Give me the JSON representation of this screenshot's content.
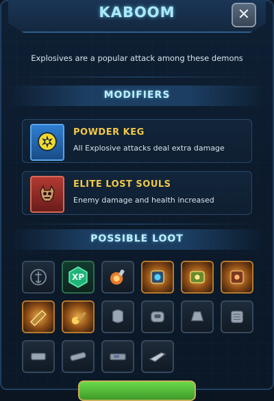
{
  "dialog": {
    "title": "KABOOM",
    "description": "Explosives are a popular attack among these demons"
  },
  "modifiers_section": {
    "title": "MODIFIERS"
  },
  "modifiers": [
    {
      "name": "POWDER KEG",
      "description": "All Explosive attacks deal extra damage",
      "icon": "explosion-icon",
      "color": "#2e7fd1"
    },
    {
      "name": "ELITE LOST SOULS",
      "description": "Enemy damage and health increased",
      "icon": "demon-skull-icon",
      "color": "#b33a32"
    }
  ],
  "loot_section": {
    "title": "POSSIBLE LOOT"
  },
  "loot_items": [
    {
      "icon": "emblem-icon",
      "style": "dark",
      "label": ""
    },
    {
      "icon": "xp-icon",
      "style": "green",
      "label": "XP"
    },
    {
      "icon": "explosive-rune-icon",
      "style": "dark",
      "label": ""
    },
    {
      "icon": "mod-cell-icon",
      "style": "orange",
      "label": ""
    },
    {
      "icon": "mod-cell-icon",
      "style": "orange",
      "label": ""
    },
    {
      "icon": "mod-cell-icon",
      "style": "orange",
      "label": ""
    },
    {
      "icon": "weapon-mod-icon",
      "style": "orange",
      "label": ""
    },
    {
      "icon": "weapon-mod-icon",
      "style": "orange",
      "label": ""
    },
    {
      "icon": "armor-piece-icon",
      "style": "dark",
      "label": ""
    },
    {
      "icon": "armor-piece-icon",
      "style": "dark",
      "label": ""
    },
    {
      "icon": "armor-piece-icon",
      "style": "dark",
      "label": ""
    },
    {
      "icon": "armor-piece-icon",
      "style": "dark",
      "label": ""
    },
    {
      "icon": "gun-part-icon",
      "style": "dark",
      "label": ""
    },
    {
      "icon": "gun-part-icon",
      "style": "dark",
      "label": ""
    },
    {
      "icon": "gun-part-icon",
      "style": "dark",
      "label": ""
    },
    {
      "icon": "gun-part-icon",
      "style": "dark",
      "label": ""
    }
  ],
  "colors": {
    "accent": "#a9eaff",
    "modifier_name": "#f3c84a",
    "confirm_button": "#6bd94a"
  }
}
